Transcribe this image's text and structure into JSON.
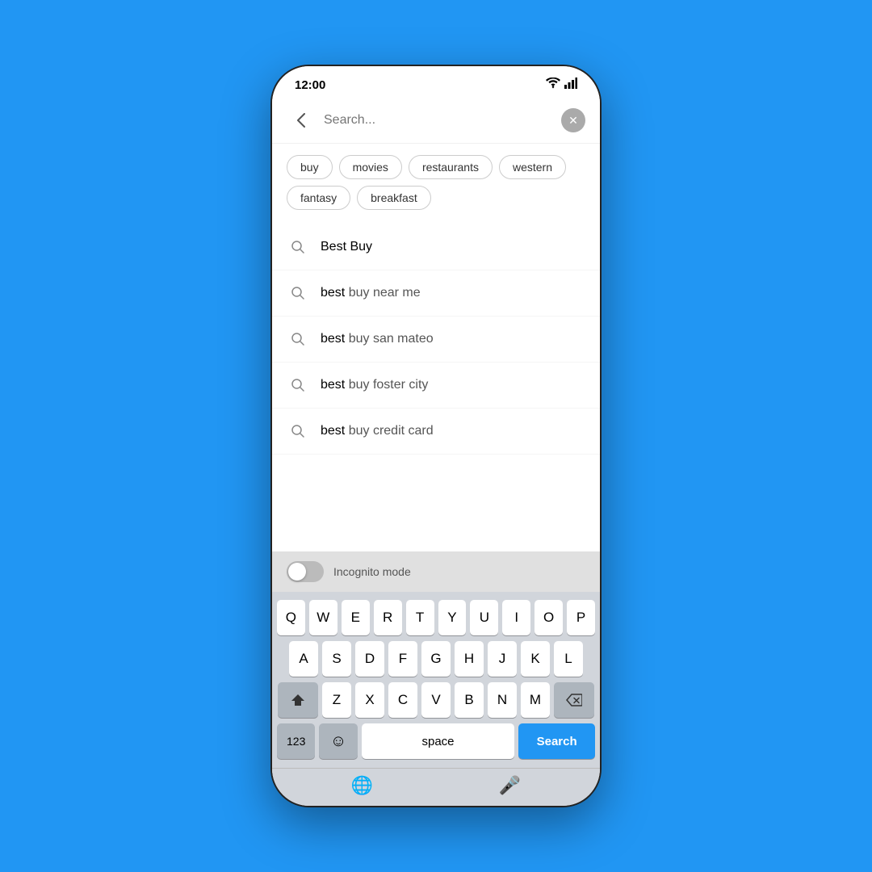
{
  "phone": {
    "status": {
      "time": "12:00"
    },
    "background_color": "#2196F3"
  },
  "search_header": {
    "back_label": "‹",
    "clear_label": "✕"
  },
  "chips": {
    "row1": [
      "buy",
      "movies",
      "restaurants",
      "western"
    ],
    "row2": [
      "fantasy",
      "breakfast"
    ]
  },
  "suggestions": [
    {
      "text": "Best Buy",
      "highlight": "Best Buy",
      "highlight_part": "full"
    },
    {
      "text": "best buy near me",
      "bold": "best buy",
      "rest": " near me"
    },
    {
      "text": "best buy san mateo",
      "bold": "best buy",
      "rest": " san mateo"
    },
    {
      "text": "best buy foster city",
      "bold": "best buy",
      "rest": " foster city"
    },
    {
      "text": "best buy credit card",
      "bold": "best buy",
      "rest": " credit card"
    }
  ],
  "incognito": {
    "label": "Incognito mode"
  },
  "keyboard": {
    "row1": [
      "Q",
      "W",
      "E",
      "R",
      "T",
      "Y",
      "U",
      "I",
      "O",
      "P"
    ],
    "row2": [
      "A",
      "S",
      "D",
      "F",
      "G",
      "H",
      "J",
      "K",
      "L"
    ],
    "row3": [
      "Z",
      "X",
      "C",
      "V",
      "B",
      "N",
      "M"
    ],
    "special_left": "⇧",
    "special_right": "⌫",
    "numeric_label": "123",
    "emoji_label": "☺",
    "space_label": "space",
    "search_label": "Search",
    "globe_label": "🌐",
    "mic_label": "🎤"
  }
}
